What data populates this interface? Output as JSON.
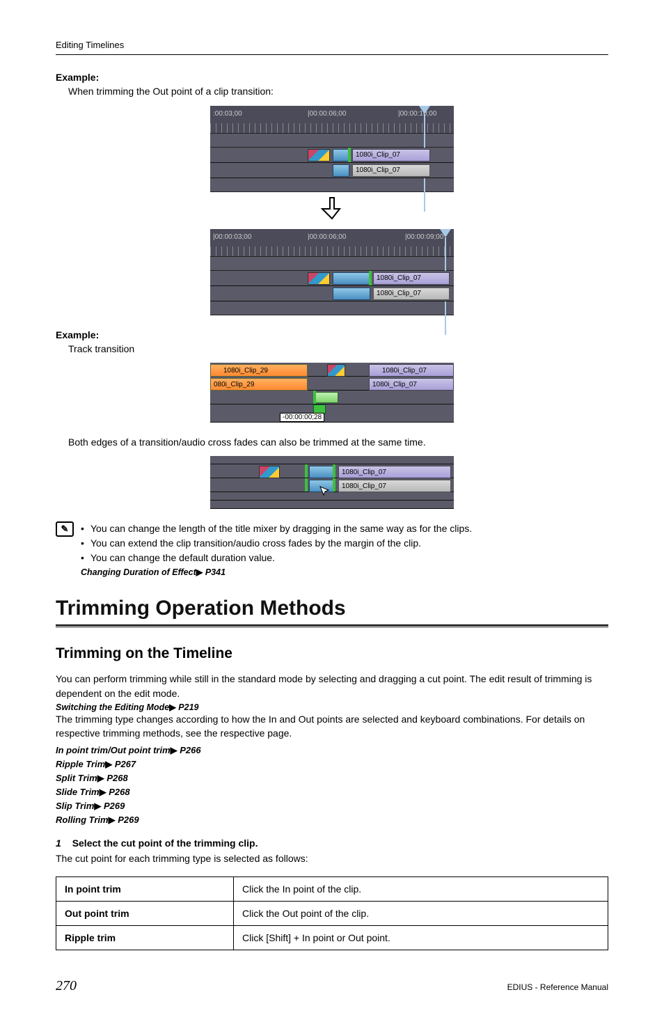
{
  "header": {
    "breadcrumb": "Editing Timelines"
  },
  "example1": {
    "heading": "Example:",
    "caption": "When trimming the Out point of a clip transition:",
    "fig_a": {
      "tc1": ":00:03;00",
      "tc2": "|00:00:06;00",
      "tc3": "|00:00:10;00",
      "clip_v": "1080i_Clip_07",
      "clip_a": "1080i_Clip_07"
    },
    "fig_b": {
      "tc1": "|00:00:03;00",
      "tc2": "|00:00:06;00",
      "tc3": "|00:00:09;00",
      "clip_v": "1080i_Clip_07",
      "clip_a": "1080i_Clip_07"
    }
  },
  "example2": {
    "heading": "Example:",
    "caption": "Track transition",
    "fig": {
      "left_v": "1080i_Clip_29",
      "left_a": "080i_Clip_29",
      "right_v": "1080i_Clip_07",
      "right_a": "1080i_Clip_07",
      "duration_label": "-00:00:00;28"
    }
  },
  "both_edges": {
    "text": "Both edges of a transition/audio cross fades can also be trimmed at the same time.",
    "fig": {
      "clip_v": "1080i_Clip_07",
      "clip_a": "1080i_Clip_07"
    }
  },
  "note": {
    "items": [
      "You can change the length of the title mixer by dragging in the same way as for the clips.",
      "You can extend the clip transition/audio cross fades by the margin of the clip.",
      "You can change the default duration value."
    ],
    "xref": {
      "label": "Changing Duration of Effect",
      "page": "P341"
    }
  },
  "section": {
    "title": "Trimming Operation Methods",
    "subtitle": "Trimming on the Timeline",
    "intro1": "You can perform trimming while still in the standard mode by selecting and dragging a cut point. The edit result of trimming is dependent on the edit mode.",
    "xref_mode": {
      "label": "Switching the Editing Mode",
      "page": "P219"
    },
    "intro2": "The trimming type changes according to how the In and Out points are selected and keyboard combinations. For details on respective trimming methods, see the respective page.",
    "links": [
      {
        "label": "In point trim/Out point trim",
        "page": "P266"
      },
      {
        "label": "Ripple Trim",
        "page": "P267"
      },
      {
        "label": "Split Trim",
        "page": "P268"
      },
      {
        "label": "Slide Trim",
        "page": "P268"
      },
      {
        "label": "Slip Trim",
        "page": "P269"
      },
      {
        "label": "Rolling Trim",
        "page": "P269"
      }
    ]
  },
  "step1": {
    "num": "1",
    "text": "Select the cut point of the trimming clip.",
    "after": "The cut point for each trimming type is selected as follows:"
  },
  "table": {
    "rows": [
      {
        "h": "In point trim",
        "d": "Click the In point of the clip."
      },
      {
        "h": "Out point trim",
        "d": "Click the Out point of the clip."
      },
      {
        "h": "Ripple trim",
        "d": "Click [Shift] + In point or Out point."
      }
    ]
  },
  "footer": {
    "page": "270",
    "manual": "EDIUS - Reference Manual"
  }
}
